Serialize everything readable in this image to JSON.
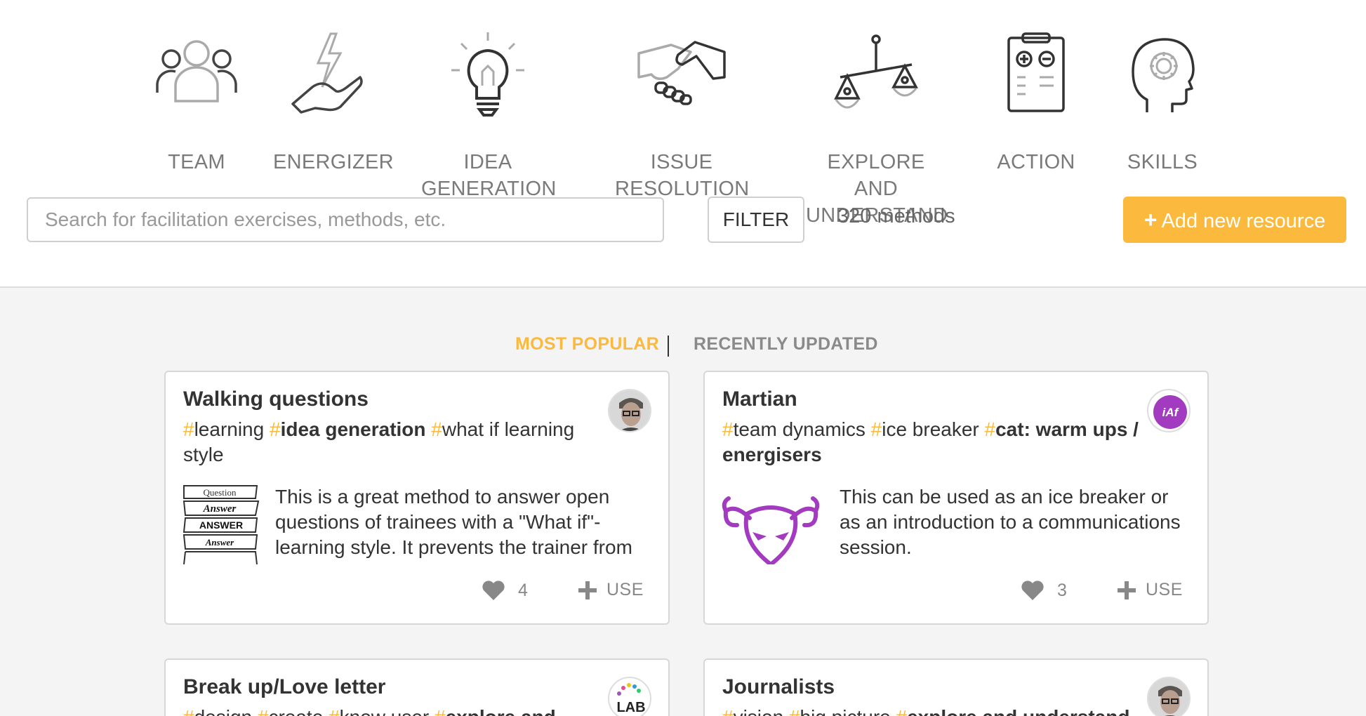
{
  "categories": [
    {
      "label_line1": "TEAM",
      "label_line2": "",
      "icon": "team-icon"
    },
    {
      "label_line1": "ENERGIZER",
      "label_line2": "",
      "icon": "energizer-icon"
    },
    {
      "label_line1": "IDEA",
      "label_line2": "GENERATION",
      "icon": "lightbulb-icon"
    },
    {
      "label_line1": "ISSUE",
      "label_line2": "RESOLUTION",
      "icon": "handshake-icon"
    },
    {
      "label_line1": "EXPLORE AND",
      "label_line2": "UNDERSTAND",
      "icon": "scale-icon"
    },
    {
      "label_line1": "ACTION",
      "label_line2": "",
      "icon": "clipboard-icon"
    },
    {
      "label_line1": "SKILLS",
      "label_line2": "",
      "icon": "head-gear-icon"
    }
  ],
  "search": {
    "placeholder": "Search for facilitation exercises, methods, etc.",
    "value": ""
  },
  "filter_label": "FILTER",
  "method_count": "320 methods",
  "add_resource": {
    "plus": "+",
    "label": "Add new resource"
  },
  "tabs": {
    "most_popular": "MOST POPULAR",
    "recently_updated": "RECENTLY UPDATED"
  },
  "tag_hash": "#",
  "cards": [
    {
      "title": "Walking questions",
      "tags": [
        "learning",
        "idea generation",
        "what if learning style"
      ],
      "description": "This is a great method to answer open questions of trainees with a \"What if\"-learning style. It prevents the trainer from",
      "likes": "4",
      "use_label": "USE",
      "thumb_lines": [
        "Question",
        "Answer",
        "ANSWER",
        "Answer"
      ]
    },
    {
      "title": "Martian",
      "tags": [
        "team dynamics",
        "ice breaker",
        "cat: warm ups / energisers"
      ],
      "description": "This can be used as an ice breaker or as an introduction to a communications session.",
      "likes": "3",
      "use_label": "USE",
      "avatar_text": "iAf"
    },
    {
      "title": "Break up/Love letter",
      "tags": [
        "design",
        "create",
        "know user",
        "explore and"
      ],
      "avatar_text": "LAB"
    },
    {
      "title": "Journalists",
      "tags": [
        "vision",
        "big picture",
        "explore and understand"
      ]
    }
  ],
  "colors": {
    "accent": "#fbb93d",
    "purple": "#a23bbf",
    "text": "#333333"
  }
}
